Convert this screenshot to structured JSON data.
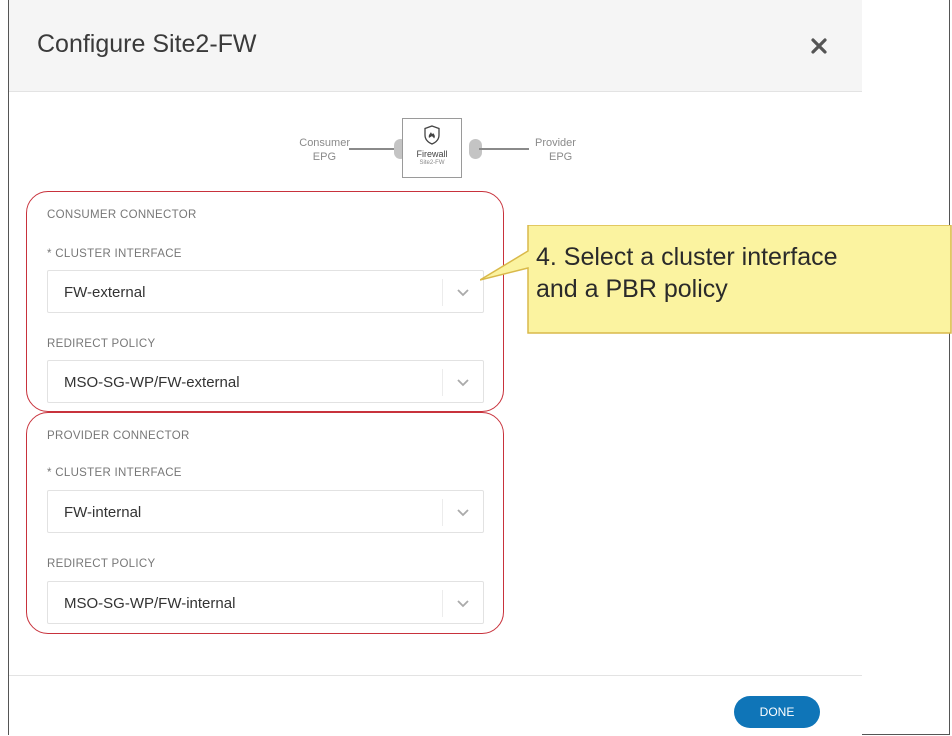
{
  "dialog": {
    "title": "Configure Site2-FW",
    "close_icon": "close-icon",
    "done_label": "DONE"
  },
  "diagram": {
    "consumer": {
      "line1": "Consumer",
      "line2": "EPG"
    },
    "provider": {
      "line1": "Provider",
      "line2": "EPG"
    },
    "device": {
      "name": "Firewall",
      "subtitle": "Site2-FW",
      "icon": "firewall-icon"
    }
  },
  "consumer_connector": {
    "title": "CONSUMER CONNECTOR",
    "cluster_interface": {
      "label": "* CLUSTER INTERFACE",
      "value": "FW-external"
    },
    "redirect_policy": {
      "label": "REDIRECT POLICY",
      "value": "MSO-SG-WP/FW-external"
    }
  },
  "provider_connector": {
    "title": "PROVIDER CONNECTOR",
    "cluster_interface": {
      "label": "* CLUSTER INTERFACE",
      "value": "FW-internal"
    },
    "redirect_policy": {
      "label": "REDIRECT POLICY",
      "value": "MSO-SG-WP/FW-internal"
    }
  },
  "callout": {
    "text": "4. Select a cluster interface\nand a PBR policy"
  },
  "colors": {
    "accent": "#0f75b8",
    "highlight_border": "#c8323c",
    "callout_fill": "#fbf3a0",
    "callout_border": "#d9b94a"
  }
}
